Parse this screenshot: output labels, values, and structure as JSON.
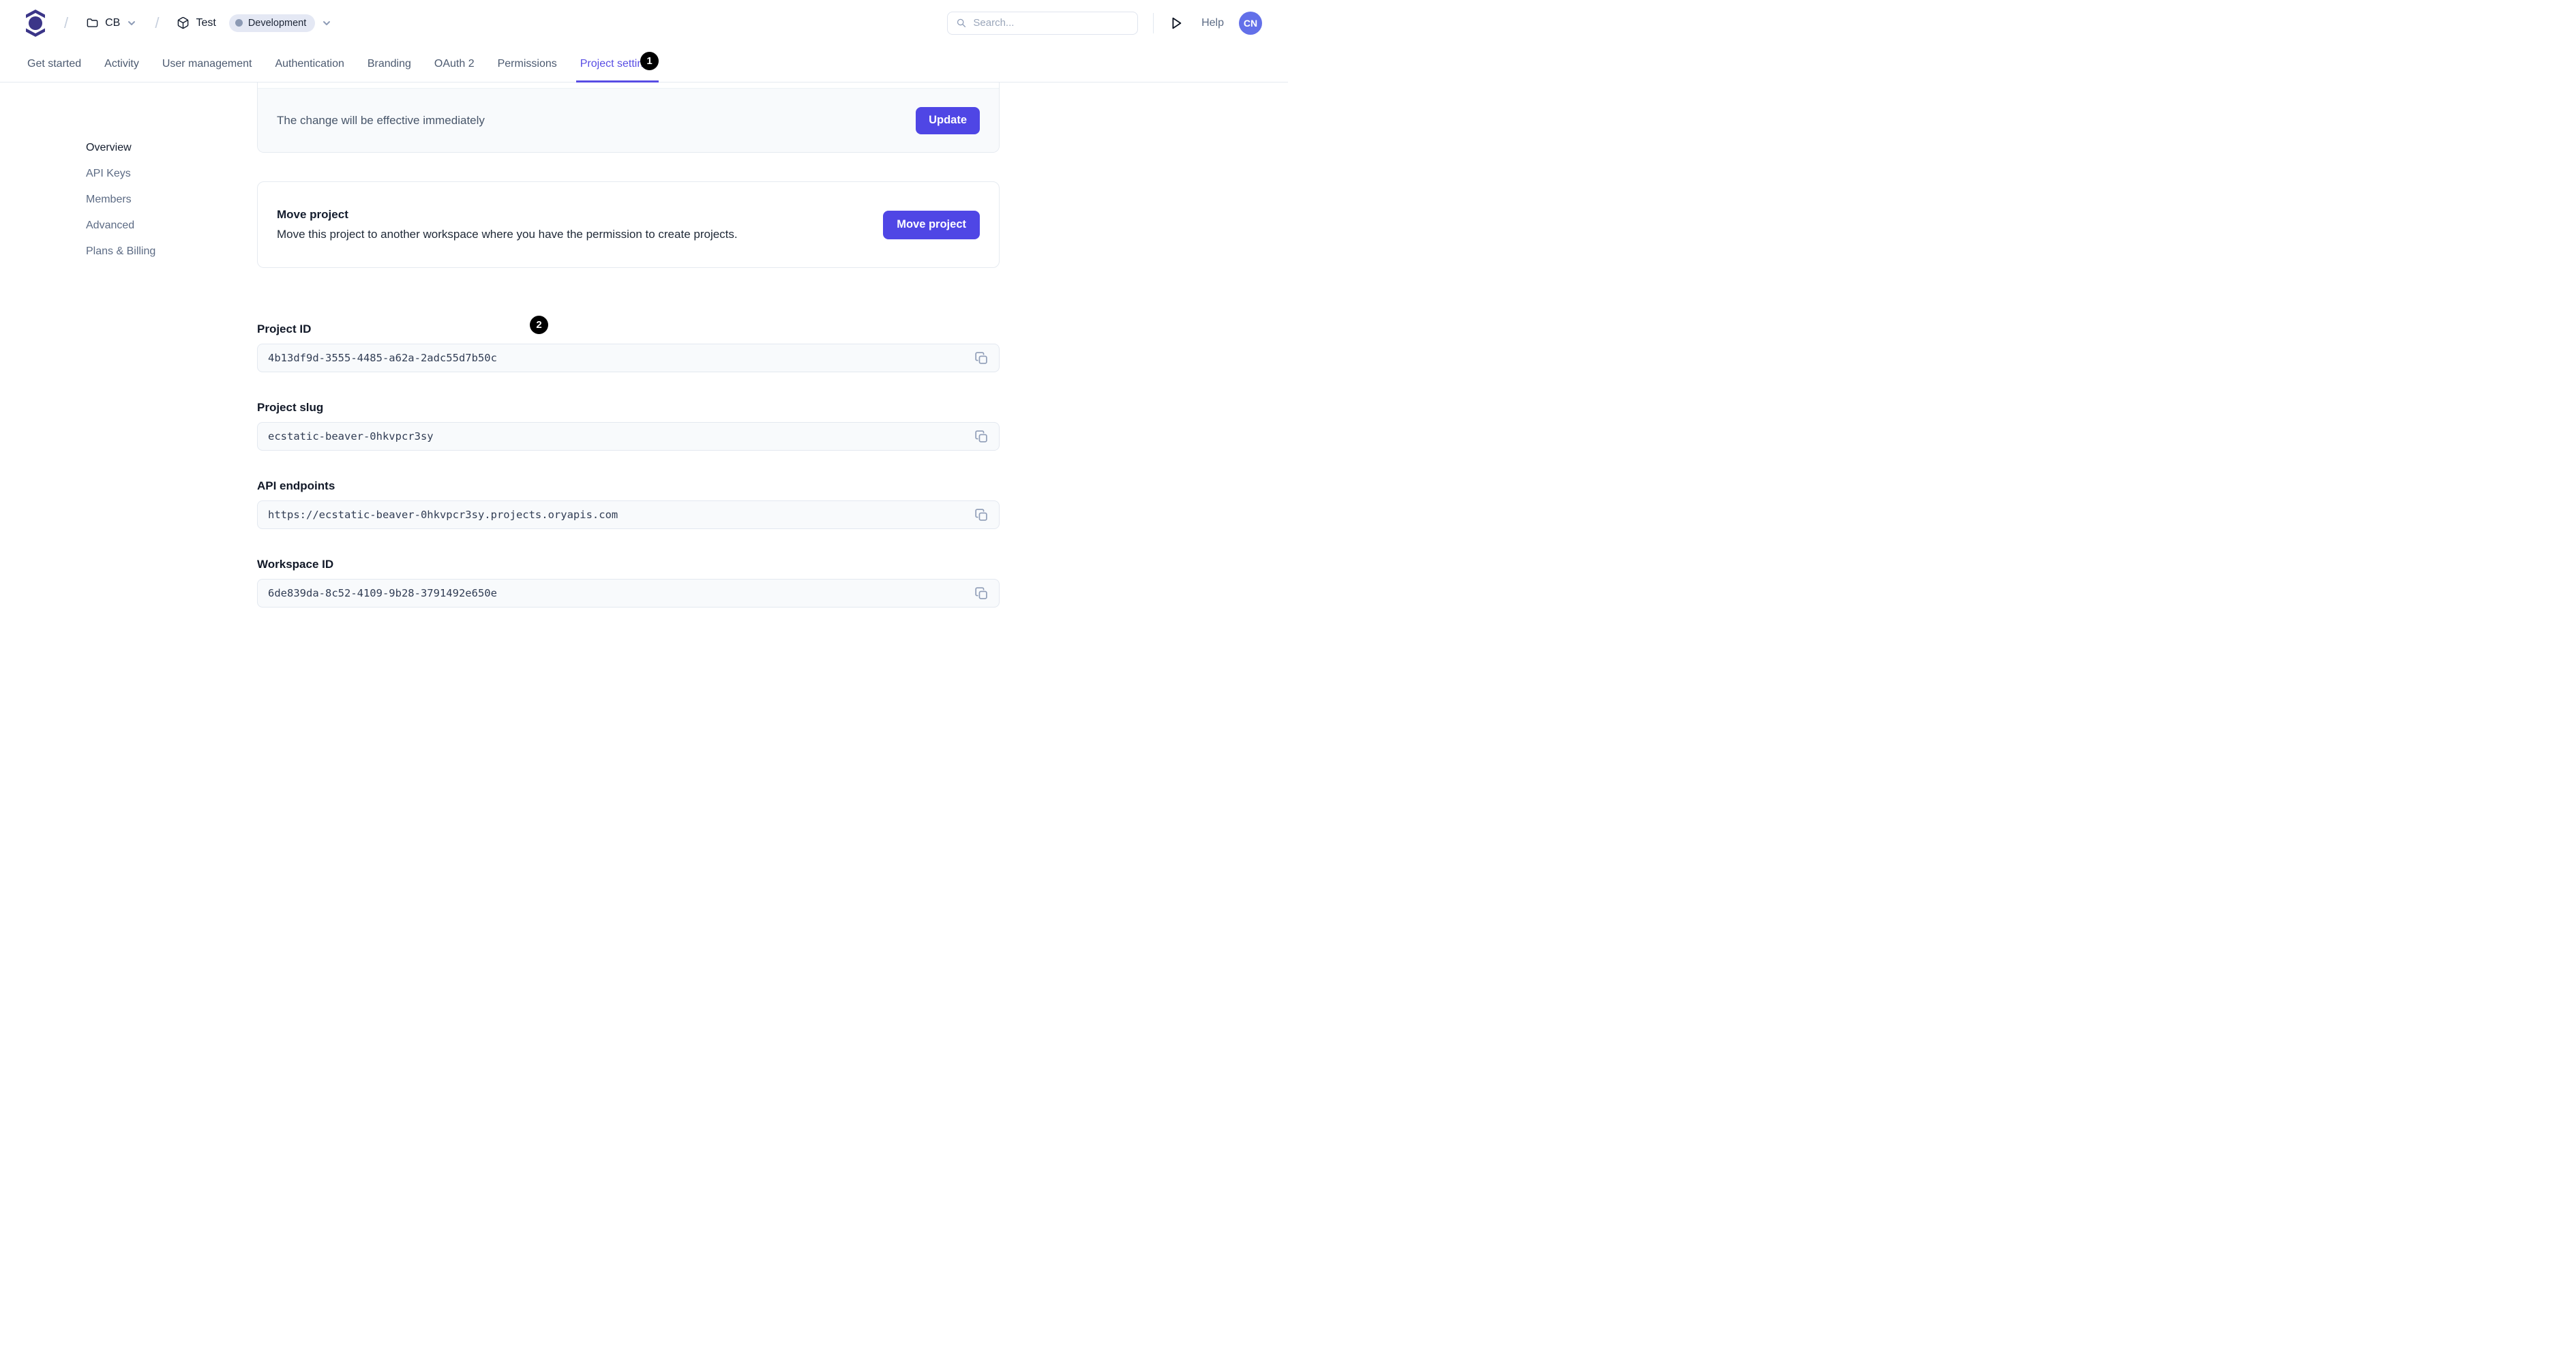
{
  "header": {
    "breadcrumb": {
      "workspace": "CB",
      "project": "Test",
      "environment_badge": "Development"
    },
    "search": {
      "placeholder": "Search..."
    },
    "help_label": "Help",
    "avatar_initials": "CN"
  },
  "tabs": [
    {
      "label": "Get started",
      "active": false
    },
    {
      "label": "Activity",
      "active": false
    },
    {
      "label": "User management",
      "active": false
    },
    {
      "label": "Authentication",
      "active": false
    },
    {
      "label": "Branding",
      "active": false
    },
    {
      "label": "OAuth 2",
      "active": false
    },
    {
      "label": "Permissions",
      "active": false
    },
    {
      "label": "Project settings",
      "active": true
    }
  ],
  "sidebar": {
    "items": [
      {
        "label": "Overview",
        "active": true
      },
      {
        "label": "API Keys",
        "active": false
      },
      {
        "label": "Members",
        "active": false
      },
      {
        "label": "Advanced",
        "active": false
      },
      {
        "label": "Plans & Billing",
        "active": false
      }
    ]
  },
  "update_card": {
    "message": "The change will be effective immediately",
    "button_label": "Update"
  },
  "move_card": {
    "title": "Move project",
    "description": "Move this project to another workspace where you have the permission to create projects.",
    "button_label": "Move project"
  },
  "fields": [
    {
      "label": "Project ID",
      "value": "4b13df9d-3555-4485-a62a-2adc55d7b50c"
    },
    {
      "label": "Project slug",
      "value": "ecstatic-beaver-0hkvpcr3sy"
    },
    {
      "label": "API endpoints",
      "value": "https://ecstatic-beaver-0hkvpcr3sy.projects.oryapis.com"
    },
    {
      "label": "Workspace ID",
      "value": "6de839da-8c52-4109-9b28-3791492e650e"
    }
  ],
  "annotations": [
    {
      "label": "1"
    },
    {
      "label": "2"
    }
  ],
  "icons": {
    "logo": "ory-logo",
    "workspace": "folder-icon",
    "project": "package-icon",
    "search": "search-icon",
    "run": "play-icon",
    "copy": "copy-icon",
    "dropdown": "chevron-down-icon"
  },
  "colors": {
    "accent": "#4f46e5",
    "active_tab": "#584de4",
    "logo": "#3b3588",
    "avatar_bg": "#6370e9",
    "badge_bg": "#e4e8f4",
    "panel_bg": "#f8fafc",
    "border": "#e5eaf0",
    "annotation_bg": "#000000"
  }
}
